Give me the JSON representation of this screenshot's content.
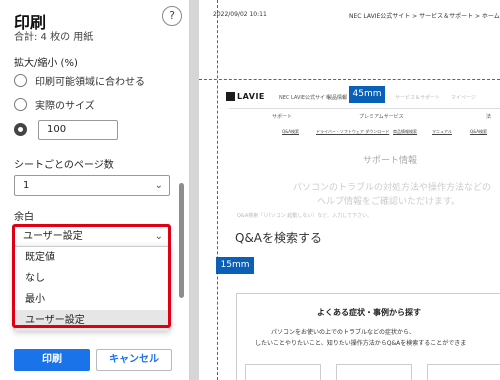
{
  "print_pane": {
    "title": "印刷",
    "total": "合計: 4 枚の 用紙",
    "help": "?",
    "scale": {
      "label": "拡大/縮小 (%)",
      "options": [
        "印刷可能領域に合わせる",
        "実際のサイズ"
      ],
      "custom_value": "100"
    },
    "pages_per_sheet": {
      "label": "シートごとのページ数",
      "value": "1"
    },
    "margins": {
      "label": "余白",
      "value": "ユーザー設定",
      "options": [
        "既定値",
        "なし",
        "最小",
        "ユーザー設定"
      ],
      "highlight_color": "#e00015"
    },
    "print_button": "印刷",
    "cancel_button": "キャンセル",
    "accent_color": "#1a73e8"
  },
  "preview": {
    "header_date": "2022/09/02 10:11",
    "header_title": "NEC LAVIE公式サイト > サービス＆サポート > ホームページ",
    "guide_top_label": "45mm",
    "guide_left_label": "15mm",
    "logo": "LAVIE",
    "site_name": "NEC LAVIE公式サイト",
    "nav": [
      "製品情報",
      "サービス＆サポート",
      "マイページ"
    ],
    "tabs": [
      "サポート",
      "プレミアムサービス",
      "法"
    ],
    "sublinks": [
      "Q&A検索",
      "ドライバー・ソフトウェア ダウンロード",
      "商品情報検索",
      "マニュアル",
      "Q&A検索"
    ],
    "support_title": "サポート情報",
    "support_lead": [
      "パソコンのトラブルの対処方法や操作方法などの",
      "ヘルプ情報をご確認いただけます。"
    ],
    "qa_hint": "Q&A検索「（パソコン 起動しない）など、入力して下さい。",
    "qa_title": "Q&Aを検索する",
    "faq_title": "よくある症状・事例から探す",
    "faq_text": [
      "パソコンをお使いの上でのトラブルなどの症状から、",
      "したいことやりたいこと、知りたい操作方法からQ&Aを検索することができま"
    ],
    "guide_color": "#0a5fb6"
  }
}
